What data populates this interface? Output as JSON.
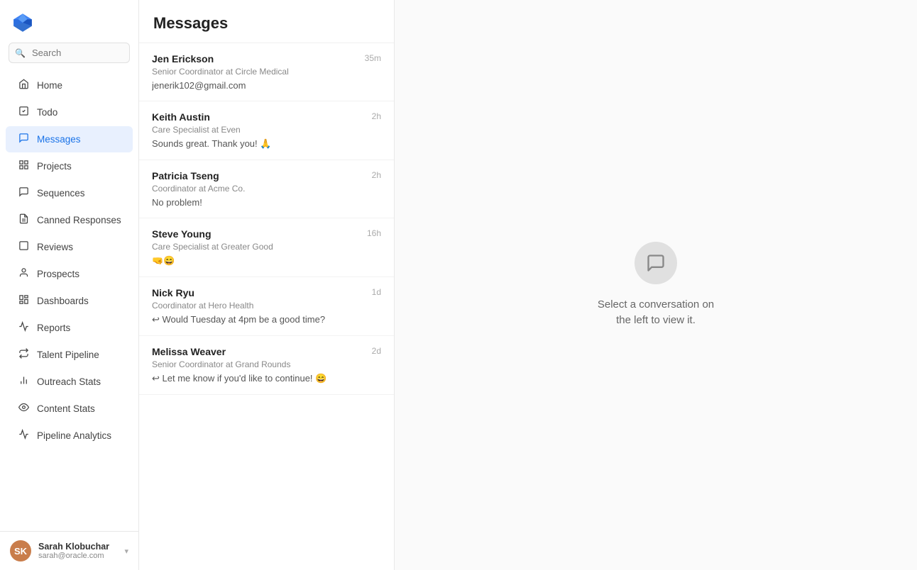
{
  "sidebar": {
    "logo_alt": "diamond logo",
    "search_placeholder": "Search",
    "nav_items": [
      {
        "id": "home",
        "label": "Home",
        "icon": "🏠",
        "active": false
      },
      {
        "id": "todo",
        "label": "Todo",
        "icon": "✅",
        "active": false
      },
      {
        "id": "messages",
        "label": "Messages",
        "icon": "✉️",
        "active": true
      },
      {
        "id": "projects",
        "label": "Projects",
        "icon": "📁",
        "active": false
      },
      {
        "id": "sequences",
        "label": "Sequences",
        "icon": "💬",
        "active": false
      },
      {
        "id": "canned-responses",
        "label": "Canned Responses",
        "icon": "📋",
        "active": false
      },
      {
        "id": "reviews",
        "label": "Reviews",
        "icon": "⬛",
        "active": false
      },
      {
        "id": "prospects",
        "label": "Prospects",
        "icon": "👤",
        "active": false
      },
      {
        "id": "dashboards",
        "label": "Dashboards",
        "icon": "📊",
        "active": false
      },
      {
        "id": "reports",
        "label": "Reports",
        "icon": "📈",
        "active": false
      },
      {
        "id": "talent-pipeline",
        "label": "Talent Pipeline",
        "icon": "🎯",
        "active": false
      },
      {
        "id": "outreach-stats",
        "label": "Outreach Stats",
        "icon": "📡",
        "active": false
      },
      {
        "id": "content-stats",
        "label": "Content Stats",
        "icon": "👁",
        "active": false
      },
      {
        "id": "pipeline-analytics",
        "label": "Pipeline Analytics",
        "icon": "📉",
        "active": false
      }
    ],
    "user": {
      "name": "Sarah Klobuchar",
      "email": "sarah@oracle.com",
      "avatar_initials": "SK"
    }
  },
  "messages": {
    "title": "Messages",
    "conversations": [
      {
        "id": 1,
        "name": "Jen Erickson",
        "role": "Senior Coordinator at Circle Medical",
        "preview": "jenerik102@gmail.com",
        "time": "35m",
        "has_reply_icon": false
      },
      {
        "id": 2,
        "name": "Keith Austin",
        "role": "Care Specialist at Even",
        "preview": "Sounds great. Thank you! 🙏",
        "time": "2h",
        "has_reply_icon": false
      },
      {
        "id": 3,
        "name": "Patricia Tseng",
        "role": "Coordinator at Acme Co.",
        "preview": "No problem!",
        "time": "2h",
        "has_reply_icon": false
      },
      {
        "id": 4,
        "name": "Steve Young",
        "role": "Care Specialist at Greater Good",
        "preview": "🤜😄",
        "time": "16h",
        "has_reply_icon": false
      },
      {
        "id": 5,
        "name": "Nick Ryu",
        "role": "Coordinator at Hero Health",
        "preview": "↩ Would Tuesday at 4pm be a good time?",
        "time": "1d",
        "has_reply_icon": true
      },
      {
        "id": 6,
        "name": "Melissa Weaver",
        "role": "Senior Coordinator at Grand Rounds",
        "preview": "↩ Let me know if you'd like to continue! 😄",
        "time": "2d",
        "has_reply_icon": true
      }
    ]
  },
  "empty_state": {
    "line1": "Select a conversation on",
    "line2": "the left to view it."
  }
}
